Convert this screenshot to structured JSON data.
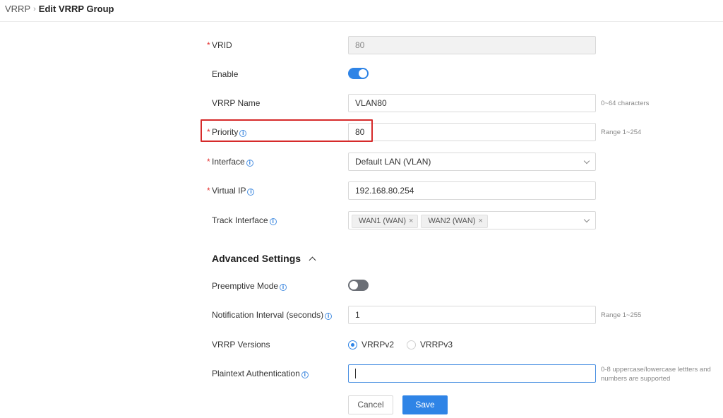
{
  "breadcrumb": {
    "parent": "VRRP",
    "separator": "›",
    "current": "Edit VRRP Group"
  },
  "form": {
    "vrid": {
      "label": "VRID",
      "required": "*",
      "value": "80"
    },
    "enable": {
      "label": "Enable",
      "state": "on"
    },
    "vrrp_name": {
      "label": "VRRP Name",
      "value": "VLAN80",
      "hint": "0~64 characters"
    },
    "priority": {
      "label": "Priority",
      "required": "*",
      "info": "i",
      "value": "80",
      "hint": "Range 1~254"
    },
    "interface": {
      "label": "Interface",
      "required": "*",
      "info": "i",
      "value": "Default LAN (VLAN)"
    },
    "virtual_ip": {
      "label": "Virtual IP",
      "required": "*",
      "info": "i",
      "value": "192.168.80.254"
    },
    "track_interface": {
      "label": "Track Interface",
      "info": "i",
      "tags": [
        "WAN1 (WAN)",
        "WAN2 (WAN)"
      ],
      "remove_glyph": "×"
    }
  },
  "advanced": {
    "title": "Advanced Settings",
    "preemptive_mode": {
      "label": "Preemptive Mode",
      "info": "i",
      "state": "off"
    },
    "notification_interval": {
      "label": "Notification Interval (seconds)",
      "info": "i",
      "value": "1",
      "hint": "Range 1~255"
    },
    "vrrp_versions": {
      "label": "VRRP Versions",
      "options": [
        "VRRPv2",
        "VRRPv3"
      ],
      "selected": "VRRPv2"
    },
    "plaintext_auth": {
      "label": "Plaintext Authentication",
      "info": "i",
      "value": "",
      "hint_line1": "0-8 uppercase/lowercase lettters and",
      "hint_line2": "numbers are supported"
    }
  },
  "buttons": {
    "cancel": "Cancel",
    "save": "Save"
  },
  "colors": {
    "accent": "#2f84e6",
    "required": "#e5312f",
    "highlight": "#d62a2a"
  }
}
